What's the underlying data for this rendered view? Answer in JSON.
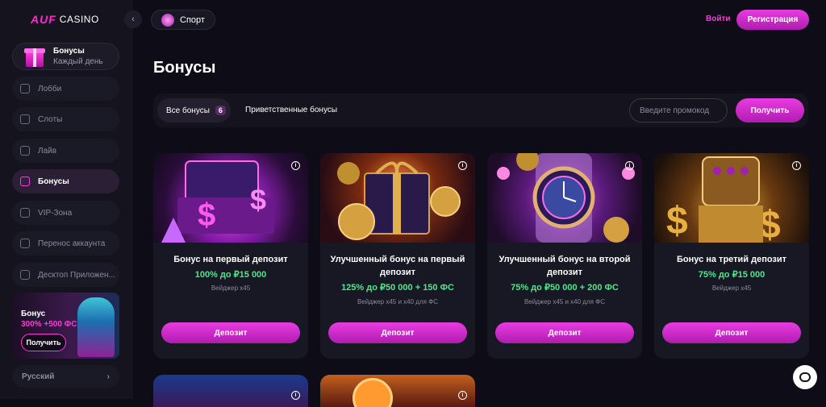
{
  "brand": {
    "logo_mark": "AUF",
    "logo_text": "CASINO"
  },
  "sidebar": {
    "bonus_card": {
      "title": "Бонусы",
      "subtitle": "Каждый день"
    },
    "items": [
      {
        "label": "Лобби",
        "icon": "home-icon"
      },
      {
        "label": "Слоты",
        "icon": "slots-icon"
      },
      {
        "label": "Лайв",
        "icon": "live-icon"
      },
      {
        "label": "Бонусы",
        "icon": "bonus-icon",
        "active": true
      },
      {
        "label": "VIP-Зона",
        "icon": "vip-icon"
      },
      {
        "label": "Перенос аккаунта",
        "icon": "transfer-icon"
      },
      {
        "label": "Десктоп Приложен...",
        "icon": "desktop-icon"
      }
    ],
    "promo": {
      "title": "Бонус",
      "offer": "300% +500 ФС",
      "button": "Получить"
    },
    "language": "Русский"
  },
  "header": {
    "sport": "Спорт",
    "login": "Войти",
    "register": "Регистрация"
  },
  "page": {
    "title": "Бонусы"
  },
  "filters": {
    "all_label": "Все бонусы",
    "all_count": "6",
    "welcome_label": "Приветственные бонусы",
    "promo_placeholder": "Введите промокод",
    "get_button": "Получить"
  },
  "cards": [
    {
      "name": "Бонус на первый депозит",
      "offer": "100% до ₽15 000",
      "wager": "Вейджер x45",
      "button": "Депозит"
    },
    {
      "name": "Улучшенный бонус на первый депозит",
      "offer": "125% до ₽50 000 + 150 ФС",
      "wager": "Вейджер x45 и x40 для ФС",
      "button": "Депозит"
    },
    {
      "name": "Улучшенный бонус на второй депозит",
      "offer": "75% до ₽50 000 + 200 ФС",
      "wager": "Вейджер x45 и x40 для ФС",
      "button": "Депозит"
    },
    {
      "name": "Бонус на третий депозит",
      "offer": "75% до ₽15 000",
      "wager": "Вейджер x45",
      "button": "Депозит"
    }
  ],
  "colors": {
    "accent": "#e83ce0",
    "offer_green": "#4ee88a",
    "background": "#0e0d17"
  }
}
